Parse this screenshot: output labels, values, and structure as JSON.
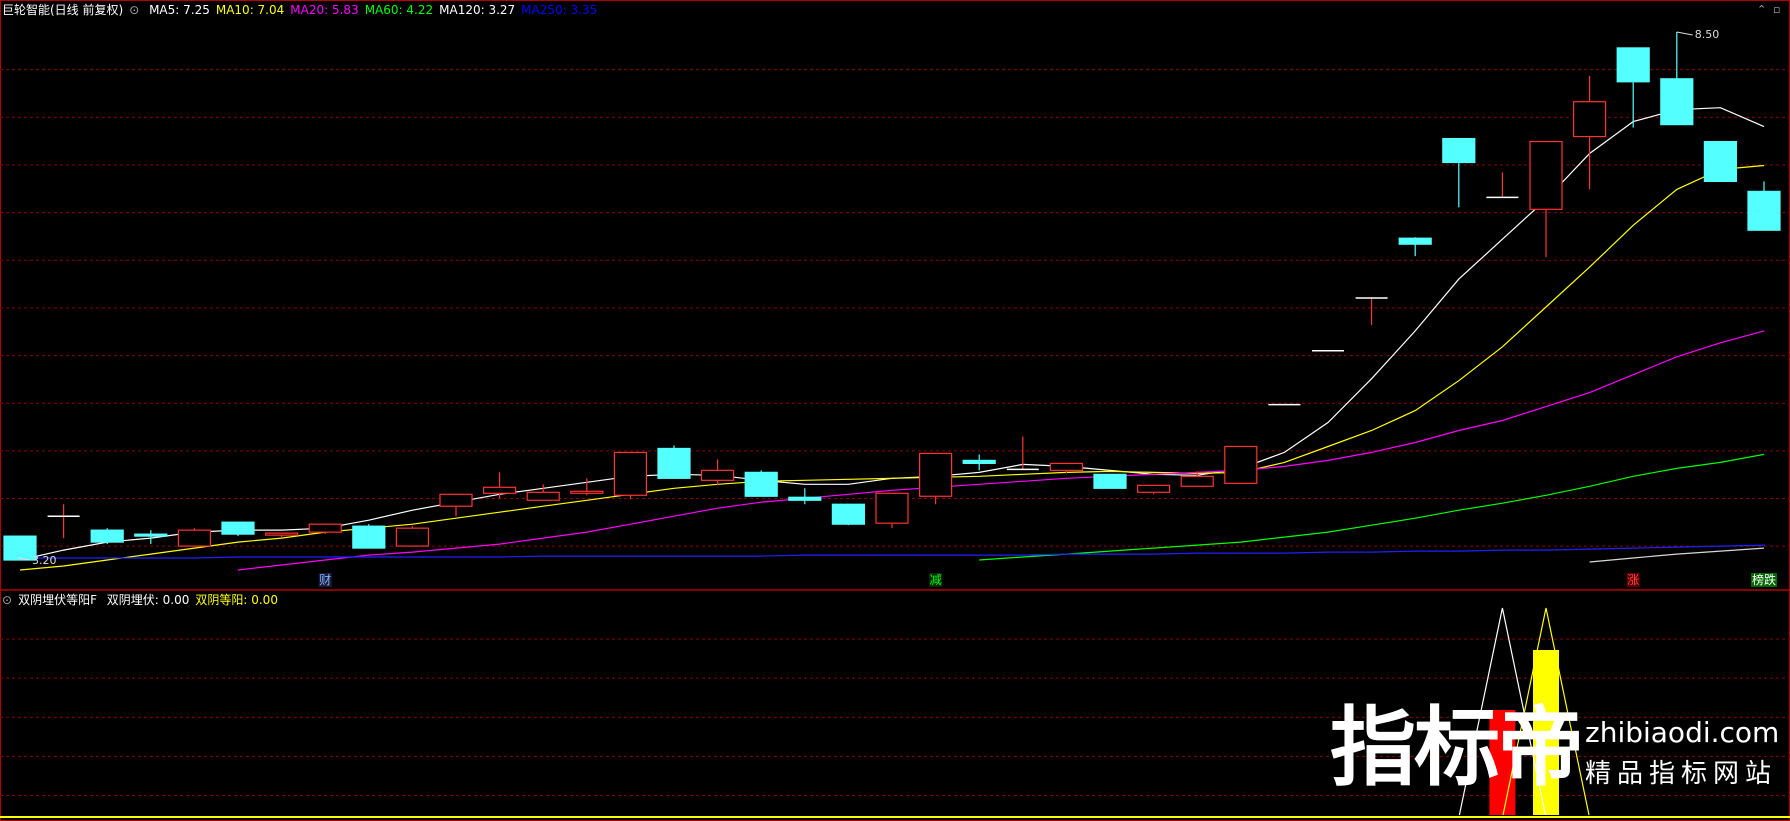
{
  "header": {
    "title": "巨轮智能(日线 前复权)",
    "ma": [
      {
        "label": "MA5: ",
        "value": "7.25",
        "color": "#ffffff"
      },
      {
        "label": "MA10: ",
        "value": "7.04",
        "color": "#ffff00"
      },
      {
        "label": "MA20: ",
        "value": "5.83",
        "color": "#ff00ff"
      },
      {
        "label": "MA60: ",
        "value": "4.22",
        "color": "#00ff00"
      },
      {
        "label": "MA120: ",
        "value": "3.27",
        "color": "#ffffff"
      },
      {
        "label": "MA250: ",
        "value": "3.35",
        "color": "#0000ff"
      }
    ]
  },
  "indicator_header": {
    "title": "双阴埋伏等阳F",
    "items": [
      {
        "label": "双阴埋伏: ",
        "value": "0.00",
        "color": "#ffffff"
      },
      {
        "label": "双阴等阳: ",
        "value": "0.00",
        "color": "#ffff00"
      }
    ]
  },
  "price_labels": {
    "high": "8.50",
    "low": "3.20"
  },
  "event_markers": [
    {
      "text": "财",
      "index": 7,
      "color": "#7fb2ff",
      "bg": "#1a1a3a"
    },
    {
      "text": "减",
      "index": 21,
      "color": "#00ff00",
      "bg": "#0a2a0a"
    },
    {
      "text": "涨",
      "index": 37,
      "color": "#ff4040",
      "bg": "#5a0000"
    },
    {
      "text": "榜跌",
      "index": 40,
      "color": "#ffffff",
      "bg": "#006600"
    }
  ],
  "watermark": {
    "brand": "指标帝",
    "domain": "zhibiaodi.com",
    "slogan": "精品指标网站"
  },
  "colors": {
    "up": "#ff3232",
    "down": "#54ffff",
    "grid": "#8b0000",
    "border": "#b40000"
  },
  "chart_data": {
    "type": "candlestick",
    "ylim": [
      3.1,
      8.6
    ],
    "candles": [
      [
        3.44,
        3.44,
        3.2,
        3.2
      ],
      [
        3.64,
        3.76,
        3.42,
        3.64
      ],
      [
        3.5,
        3.52,
        3.36,
        3.38
      ],
      [
        3.46,
        3.5,
        3.36,
        3.44
      ],
      [
        3.34,
        3.52,
        3.34,
        3.5
      ],
      [
        3.58,
        3.58,
        3.44,
        3.46
      ],
      [
        3.45,
        3.47,
        3.42,
        3.47
      ],
      [
        3.48,
        3.56,
        3.46,
        3.56
      ],
      [
        3.54,
        3.56,
        3.32,
        3.32
      ],
      [
        3.34,
        3.54,
        3.34,
        3.52
      ],
      [
        3.74,
        3.76,
        3.64,
        3.86
      ],
      [
        3.87,
        4.08,
        3.82,
        3.93
      ],
      [
        3.8,
        3.96,
        3.8,
        3.88
      ],
      [
        3.87,
        4.02,
        3.85,
        3.89
      ],
      [
        3.85,
        4.28,
        3.81,
        4.28
      ],
      [
        4.32,
        4.35,
        4.02,
        4.02
      ],
      [
        4.0,
        4.21,
        3.95,
        4.1
      ],
      [
        4.08,
        4.1,
        3.84,
        3.84
      ],
      [
        3.83,
        3.92,
        3.76,
        3.8
      ],
      [
        3.76,
        3.76,
        3.55,
        3.56
      ],
      [
        3.57,
        3.87,
        3.52,
        3.87
      ],
      [
        3.84,
        4.27,
        3.76,
        4.27
      ],
      [
        4.2,
        4.26,
        4.1,
        4.17
      ],
      [
        4.11,
        4.44,
        4.11,
        4.11
      ],
      [
        4.1,
        4.17,
        4.07,
        4.17
      ],
      [
        4.06,
        4.0,
        3.92,
        3.92
      ],
      [
        3.88,
        3.95,
        3.86,
        3.95
      ],
      [
        3.94,
        4.09,
        3.94,
        4.04
      ],
      [
        3.97,
        4.34,
        3.97,
        4.34
      ],
      [
        4.76,
        4.76,
        4.76,
        4.76
      ],
      [
        5.3,
        5.3,
        5.3,
        5.3
      ],
      [
        5.83,
        5.83,
        5.56,
        5.83
      ],
      [
        6.43,
        6.44,
        6.25,
        6.37
      ],
      [
        7.43,
        7.43,
        6.74,
        7.19
      ],
      [
        6.84,
        7.09,
        6.84,
        6.84
      ],
      [
        6.72,
        7.4,
        6.24,
        7.4
      ],
      [
        7.45,
        8.06,
        6.92,
        7.8
      ],
      [
        8.34,
        8.34,
        7.54,
        8.0
      ],
      [
        8.03,
        8.5,
        7.89,
        7.57
      ],
      [
        7.4,
        7.4,
        7.0,
        7.0
      ],
      [
        6.9,
        7.0,
        6.51,
        6.51
      ]
    ],
    "ma_lines": [
      {
        "name": "MA5",
        "color": "#ffffff",
        "values": [
          3.2,
          3.3,
          3.38,
          3.42,
          3.48,
          3.5,
          3.5,
          3.52,
          3.6,
          3.7,
          3.78,
          3.86,
          3.92,
          3.98,
          4.04,
          4.06,
          4.05,
          4.0,
          3.96,
          3.96,
          4.02,
          4.04,
          4.08,
          4.16,
          4.14,
          4.1,
          4.06,
          4.05,
          4.12,
          4.28,
          4.58,
          5.02,
          5.5,
          6.02,
          6.42,
          6.82,
          7.28,
          7.6,
          7.72,
          7.74,
          7.55
        ]
      },
      {
        "name": "MA10",
        "color": "#ffff00",
        "values": [
          3.1,
          3.14,
          3.2,
          3.26,
          3.32,
          3.38,
          3.42,
          3.48,
          3.52,
          3.56,
          3.62,
          3.68,
          3.74,
          3.8,
          3.86,
          3.92,
          3.96,
          3.99,
          4.0,
          4.01,
          4.02,
          4.03,
          4.04,
          4.06,
          4.08,
          4.09,
          4.08,
          4.07,
          4.08,
          4.18,
          4.34,
          4.5,
          4.7,
          5.0,
          5.34,
          5.74,
          6.14,
          6.56,
          6.92,
          7.12,
          7.16
        ]
      },
      {
        "name": "MA20",
        "color": "#ff00ff",
        "values": [
          null,
          null,
          null,
          null,
          null,
          3.1,
          3.15,
          3.2,
          3.25,
          3.28,
          3.32,
          3.36,
          3.42,
          3.48,
          3.56,
          3.64,
          3.72,
          3.78,
          3.82,
          3.86,
          3.9,
          3.93,
          3.96,
          3.99,
          4.02,
          4.04,
          4.06,
          4.08,
          4.1,
          4.14,
          4.2,
          4.28,
          4.38,
          4.5,
          4.6,
          4.74,
          4.88,
          5.06,
          5.24,
          5.38,
          5.5
        ]
      },
      {
        "name": "MA60",
        "color": "#00ff00",
        "values": [
          null,
          null,
          null,
          null,
          null,
          null,
          null,
          null,
          null,
          null,
          null,
          null,
          null,
          null,
          null,
          null,
          null,
          null,
          null,
          null,
          null,
          null,
          3.2,
          3.23,
          3.26,
          3.29,
          3.32,
          3.35,
          3.38,
          3.43,
          3.48,
          3.55,
          3.62,
          3.7,
          3.77,
          3.85,
          3.94,
          4.04,
          4.12,
          4.18,
          4.26
        ]
      },
      {
        "name": "MA120",
        "color": "#d8d8d8",
        "values": [
          null,
          null,
          null,
          null,
          null,
          null,
          null,
          null,
          null,
          null,
          null,
          null,
          null,
          null,
          null,
          null,
          null,
          null,
          null,
          null,
          null,
          null,
          null,
          null,
          null,
          null,
          null,
          null,
          null,
          null,
          null,
          null,
          null,
          null,
          null,
          null,
          3.18,
          3.22,
          3.26,
          3.29,
          3.32
        ]
      },
      {
        "name": "MA250",
        "color": "#2020ff",
        "values": [
          3.22,
          3.22,
          3.22,
          3.22,
          3.22,
          3.23,
          3.23,
          3.23,
          3.23,
          3.23,
          3.23,
          3.23,
          3.24,
          3.24,
          3.24,
          3.24,
          3.24,
          3.24,
          3.25,
          3.25,
          3.25,
          3.25,
          3.25,
          3.25,
          3.26,
          3.26,
          3.26,
          3.27,
          3.27,
          3.27,
          3.28,
          3.28,
          3.29,
          3.29,
          3.3,
          3.3,
          3.31,
          3.32,
          3.33,
          3.34,
          3.35
        ]
      }
    ],
    "indicator": {
      "white_peak_index": 34,
      "yellow_peak_index": 35,
      "red_bar_index": 34,
      "yellow_bar_index": 35
    }
  }
}
